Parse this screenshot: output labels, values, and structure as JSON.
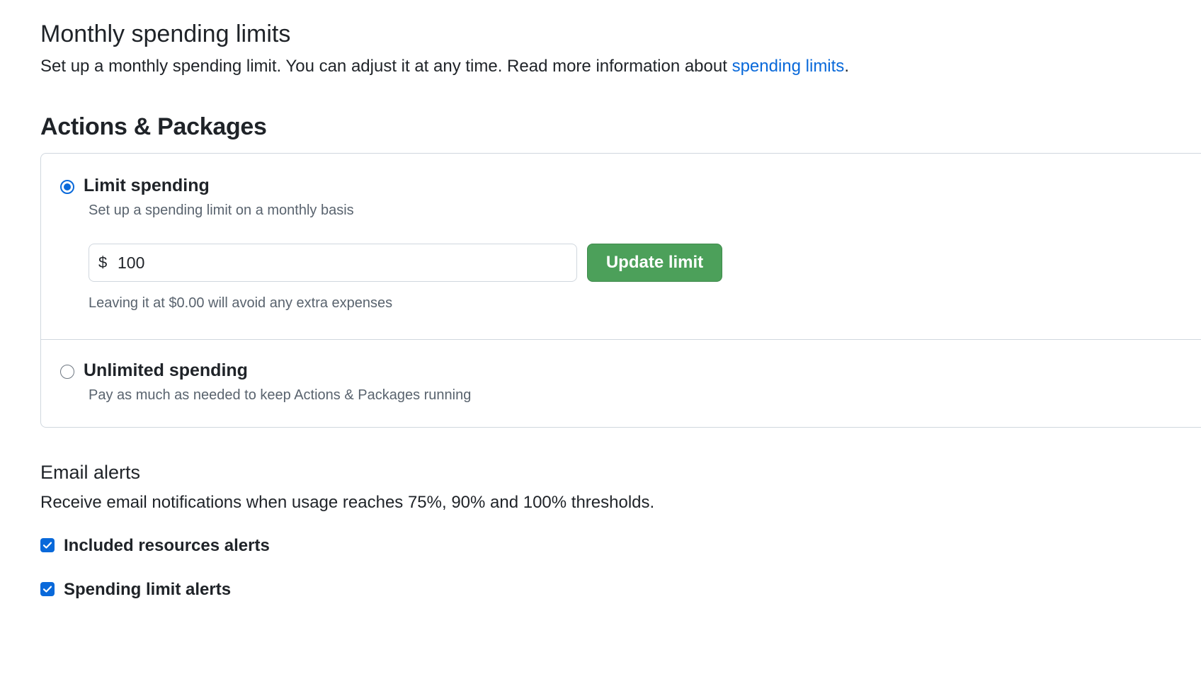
{
  "monthly": {
    "title": "Monthly spending limits",
    "description_prefix": "Set up a monthly spending limit. You can adjust it at any time. Read more information about ",
    "link_text": "spending limits",
    "description_suffix": "."
  },
  "section": {
    "title": "Actions & Packages"
  },
  "options": {
    "limit": {
      "label": "Limit spending",
      "subtitle": "Set up a spending limit on a monthly basis",
      "selected": true,
      "currency_symbol": "$",
      "amount_value": "100",
      "button_label": "Update limit",
      "hint": "Leaving it at $0.00 will avoid any extra expenses"
    },
    "unlimited": {
      "label": "Unlimited spending",
      "subtitle": "Pay as much as needed to keep Actions & Packages running",
      "selected": false
    }
  },
  "email": {
    "title": "Email alerts",
    "description": "Receive email notifications when usage reaches 75%, 90% and 100% thresholds.",
    "checkboxes": [
      {
        "label": "Included resources alerts",
        "checked": true
      },
      {
        "label": "Spending limit alerts",
        "checked": true
      }
    ]
  },
  "colors": {
    "accent_blue": "#0969da",
    "button_green": "#4ca05a",
    "border": "#d0d7de",
    "muted_text": "#59636e"
  }
}
